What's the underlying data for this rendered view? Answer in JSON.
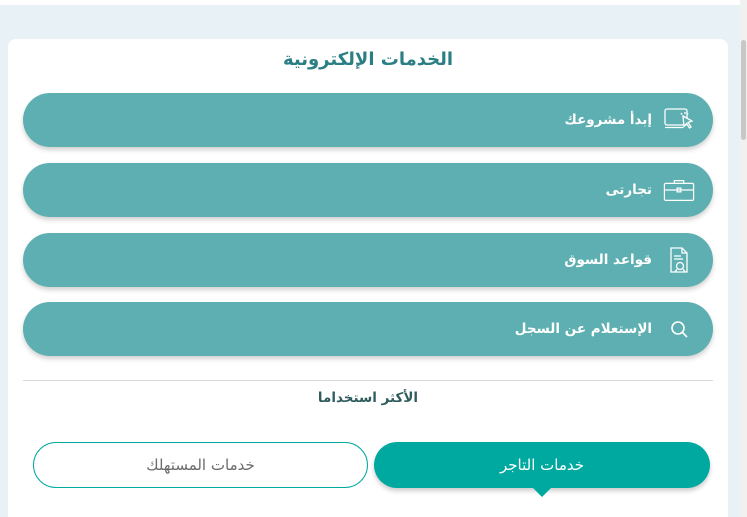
{
  "eservices": {
    "title": "الخدمات الإلكترونية",
    "buttons": [
      {
        "label": "إبدأ مشروعك",
        "icon": "monitor-cursor-icon"
      },
      {
        "label": "تجارتى",
        "icon": "briefcase-icon"
      },
      {
        "label": "قواعد السوق",
        "icon": "document-rules-icon"
      },
      {
        "label": "الإستعلام عن السجل",
        "icon": "search-icon"
      }
    ]
  },
  "most_used": {
    "title": "الأكثر استخداما"
  },
  "tabs": {
    "merchant": "خدمات التاجر",
    "consumer": "خدمات المستهلك",
    "active": "merchant"
  },
  "colors": {
    "button_bg": "#5eafb1",
    "accent": "#00a9a0",
    "title": "#2b7f84"
  }
}
